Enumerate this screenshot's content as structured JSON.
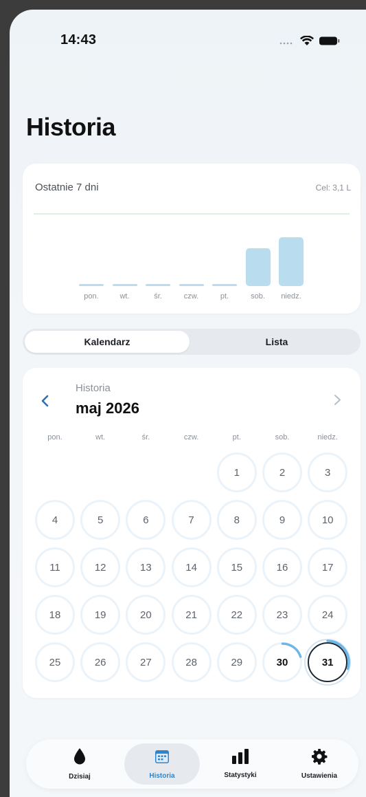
{
  "status": {
    "time": "14:43"
  },
  "page_title": "Historia",
  "week_summary": {
    "title": "Ostatnie 7 dni",
    "goal_label": "Cel: 3,1 L",
    "days": [
      {
        "label": "pon.",
        "fill": 0.0
      },
      {
        "label": "wt.",
        "fill": 0.0
      },
      {
        "label": "śr.",
        "fill": 0.0
      },
      {
        "label": "czw.",
        "fill": 0.0
      },
      {
        "label": "pt.",
        "fill": 0.0
      },
      {
        "label": "sob.",
        "fill": 0.5
      },
      {
        "label": "niedz.",
        "fill": 0.65
      }
    ]
  },
  "view_toggle": {
    "calendar": "Kalendarz",
    "list": "Lista",
    "selected": "calendar"
  },
  "calendar": {
    "subtitle": "Historia",
    "month": "maj 2026",
    "weekdays": [
      "pon.",
      "wt.",
      "śr.",
      "czw.",
      "pt.",
      "sob.",
      "niedz."
    ],
    "days": [
      "1",
      "2",
      "3",
      "4",
      "5",
      "6",
      "7",
      "8",
      "9",
      "10",
      "11",
      "12",
      "13",
      "14",
      "15",
      "16",
      "17",
      "18",
      "19",
      "20",
      "21",
      "22",
      "23",
      "24",
      "25",
      "26",
      "27",
      "28",
      "29",
      "30",
      "31"
    ],
    "first_weekday_index": 4,
    "today": "31",
    "progress": {
      "30": 0.2,
      "31": 0.3
    }
  },
  "tabbar": {
    "items": [
      {
        "label": "Dzisiaj",
        "icon": "drop-icon"
      },
      {
        "label": "Historia",
        "icon": "calendar-icon"
      },
      {
        "label": "Statystyki",
        "icon": "bar-chart-icon"
      },
      {
        "label": "Ustawienia",
        "icon": "gear-icon"
      }
    ],
    "active": 1
  },
  "colors": {
    "accent": "#2f84cc",
    "bar": "#b9dcef",
    "ring": "#ebf3fa",
    "progress": "#6fb6e8"
  }
}
